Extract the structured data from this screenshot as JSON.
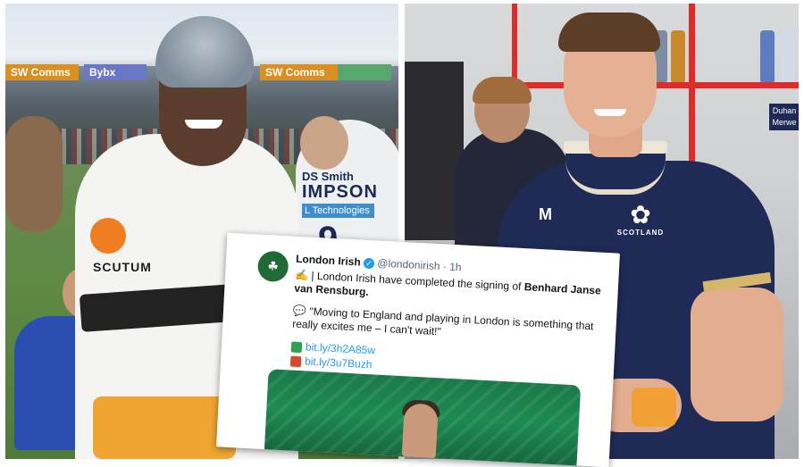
{
  "left_photo": {
    "boards": [
      "SW Comms",
      "Bybx",
      "SW Comms",
      ""
    ],
    "sponsor_text": "SCUTUM",
    "teammate_shirt": {
      "sponsor": "DS Smith",
      "name": "IMPSON",
      "tech": "L Technologies",
      "number": "9"
    }
  },
  "right_photo": {
    "crest_text": "SCOTLAND",
    "brand_logo": "M",
    "name_plate": "Duhan Merwe"
  },
  "tweet": {
    "account_name": "London Irish",
    "handle": "@londonirish",
    "time": "· 1h",
    "line1_prefix": "| London Irish have completed the signing of ",
    "line1_bold": "Benhard Janse van Rensburg.",
    "quote": "\"Moving to England and playing in London is something that really excites me – I can't wait!\"",
    "links": [
      "bit.ly/3h2A85w",
      "bit.ly/3u7Buzh"
    ]
  },
  "colors": {
    "wasps_amber": "#f0a532",
    "scotland_navy": "#1f2a57",
    "locker_red": "#e02b2b",
    "twitter_blue": "#1d9bf0",
    "london_irish_green": "#1f6b35"
  },
  "icons": {
    "verified": "verified-badge-icon",
    "pen": "writing-hand-icon",
    "speech": "speech-bubble-icon",
    "link_emoji": "clover-icon"
  }
}
